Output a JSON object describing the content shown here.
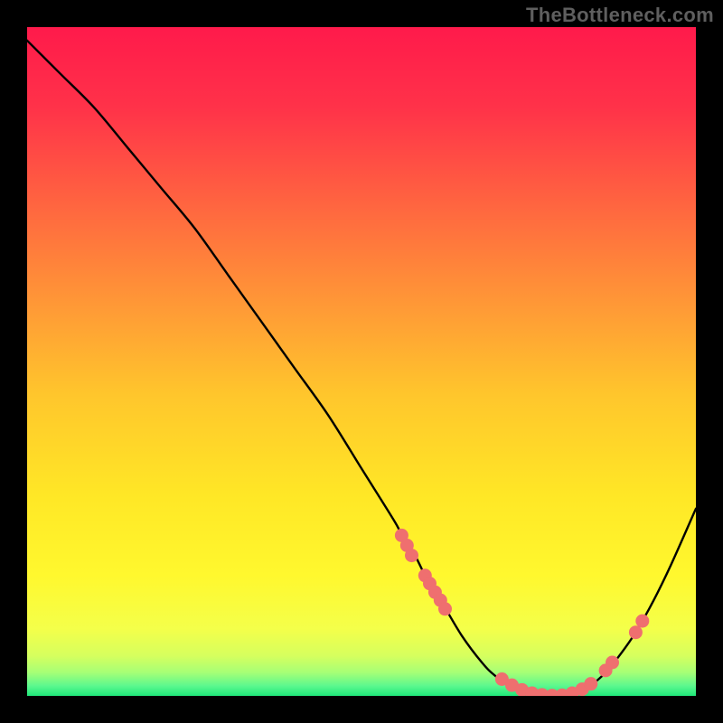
{
  "attribution": "TheBottleneck.com",
  "chart_data": {
    "type": "line",
    "title": "",
    "xlabel": "",
    "ylabel": "",
    "xlim": [
      0,
      100
    ],
    "ylim": [
      0,
      100
    ],
    "grid": false,
    "legend": false,
    "curve": {
      "name": "bottleneck-curve",
      "x": [
        0,
        5,
        10,
        15,
        20,
        25,
        30,
        35,
        40,
        45,
        50,
        55,
        56,
        58,
        60,
        62,
        65,
        68,
        70,
        73,
        76,
        80,
        83,
        86,
        90,
        93,
        96,
        100
      ],
      "y": [
        98,
        93,
        88,
        82,
        76,
        70,
        63,
        56,
        49,
        42,
        34,
        26,
        24,
        21,
        17,
        14,
        9,
        5,
        3,
        1,
        0,
        0,
        1,
        3,
        8,
        13,
        19,
        28
      ]
    },
    "marker_clusters": [
      {
        "name": "markers-left-slope",
        "points": [
          {
            "x": 56,
            "y": 24
          },
          {
            "x": 56.8,
            "y": 22.5
          },
          {
            "x": 57.5,
            "y": 21
          },
          {
            "x": 59.5,
            "y": 18
          },
          {
            "x": 60.2,
            "y": 16.8
          },
          {
            "x": 61,
            "y": 15.5
          },
          {
            "x": 61.8,
            "y": 14.3
          },
          {
            "x": 62.5,
            "y": 13
          }
        ]
      },
      {
        "name": "markers-valley",
        "points": [
          {
            "x": 71,
            "y": 2.5
          },
          {
            "x": 72.5,
            "y": 1.6
          },
          {
            "x": 74,
            "y": 0.9
          },
          {
            "x": 75.5,
            "y": 0.4
          },
          {
            "x": 77,
            "y": 0.15
          },
          {
            "x": 78.5,
            "y": 0.05
          },
          {
            "x": 80,
            "y": 0.1
          },
          {
            "x": 81.5,
            "y": 0.4
          },
          {
            "x": 83,
            "y": 1
          },
          {
            "x": 84.3,
            "y": 1.8
          }
        ]
      },
      {
        "name": "markers-right-slope",
        "points": [
          {
            "x": 86.5,
            "y": 3.8
          },
          {
            "x": 87.5,
            "y": 5
          },
          {
            "x": 91,
            "y": 9.5
          },
          {
            "x": 92,
            "y": 11.2
          }
        ]
      }
    ],
    "gradient_stops": [
      {
        "offset": 0.0,
        "color": "#ff1a4b"
      },
      {
        "offset": 0.12,
        "color": "#ff3249"
      },
      {
        "offset": 0.28,
        "color": "#ff6a3f"
      },
      {
        "offset": 0.42,
        "color": "#ff9a36"
      },
      {
        "offset": 0.55,
        "color": "#ffc62c"
      },
      {
        "offset": 0.7,
        "color": "#ffe726"
      },
      {
        "offset": 0.82,
        "color": "#fff82e"
      },
      {
        "offset": 0.9,
        "color": "#f4ff4a"
      },
      {
        "offset": 0.94,
        "color": "#d6ff5e"
      },
      {
        "offset": 0.965,
        "color": "#a6ff76"
      },
      {
        "offset": 0.985,
        "color": "#5cf88e"
      },
      {
        "offset": 1.0,
        "color": "#1fe87a"
      }
    ],
    "marker_color": "#ef6f6f",
    "curve_color": "#000000"
  }
}
